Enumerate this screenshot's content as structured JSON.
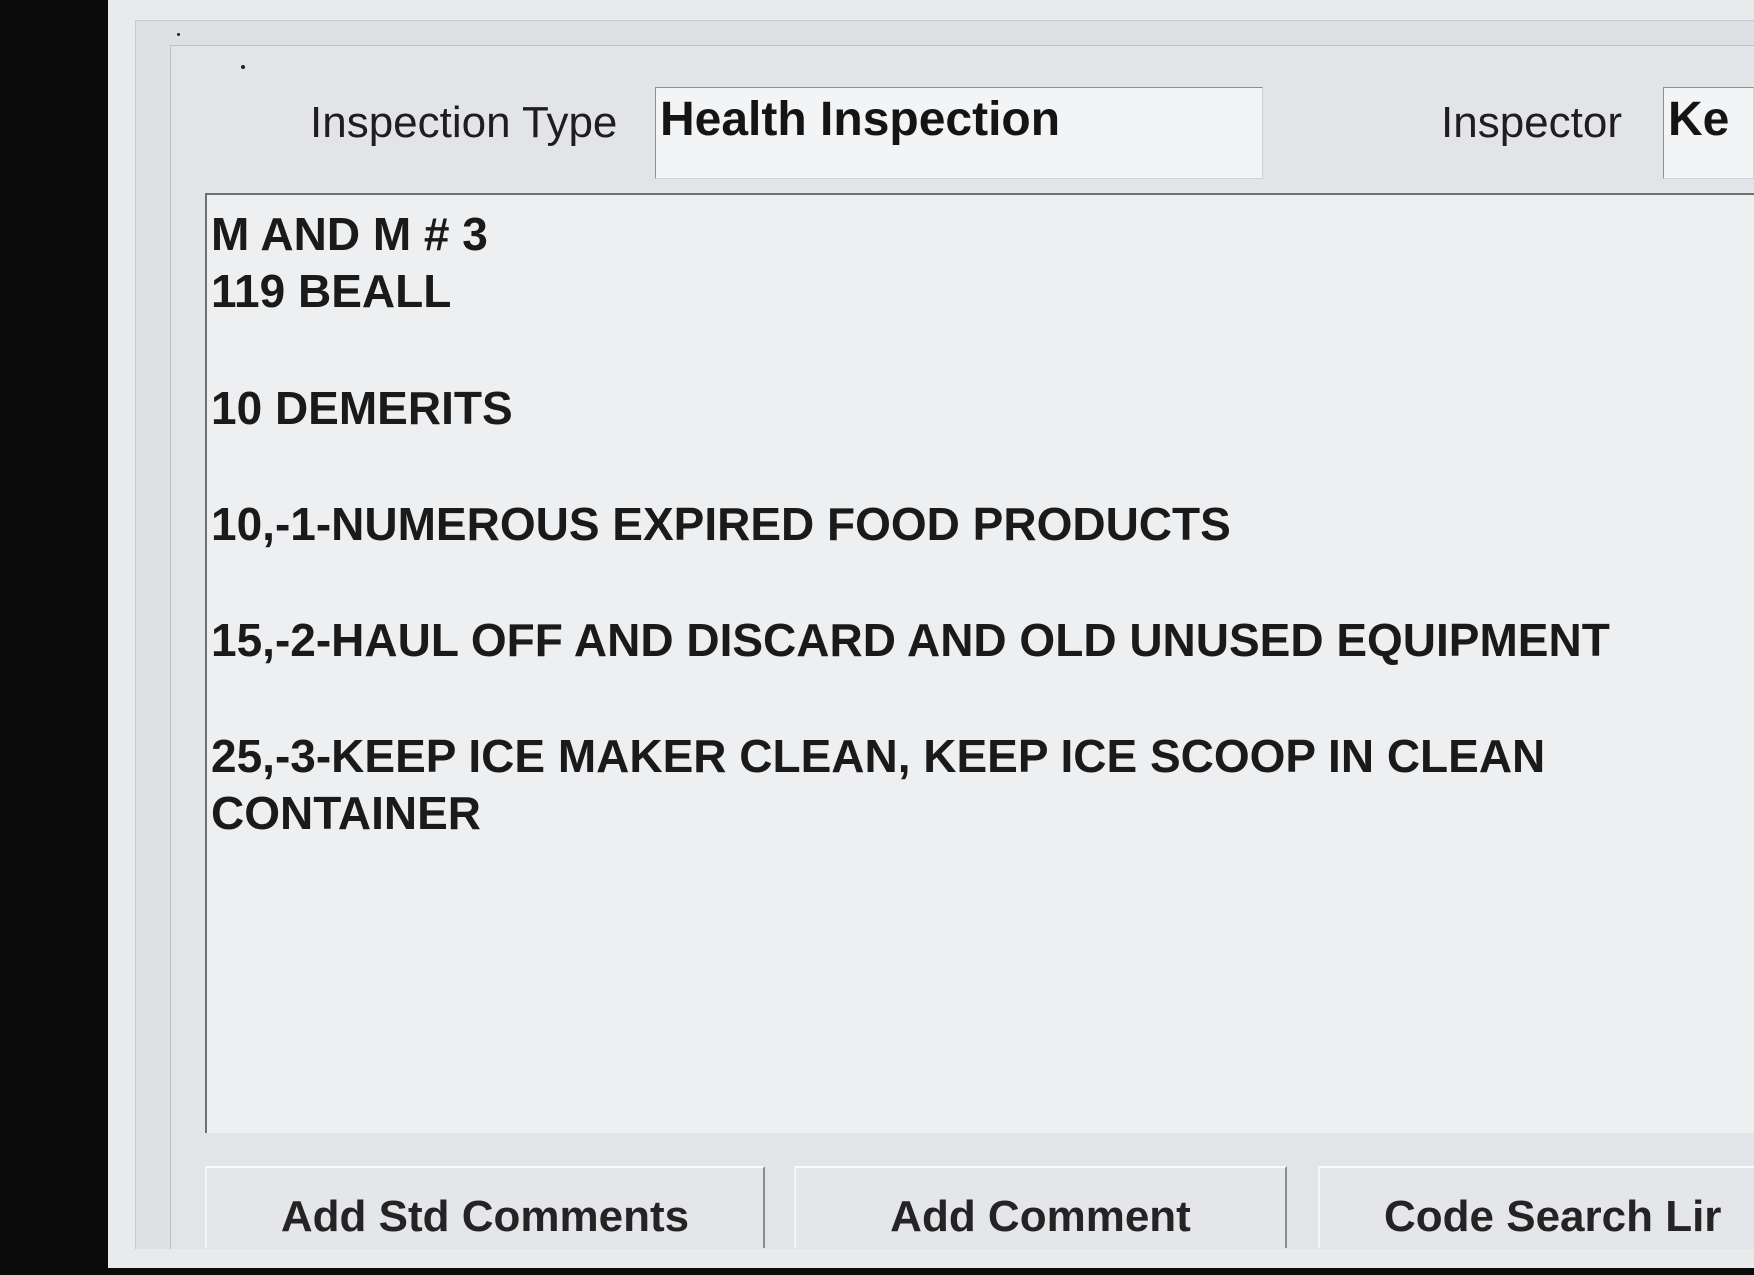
{
  "header": {
    "inspection_type_label": "Inspection Type",
    "inspection_type_value": "Health Inspection",
    "inspector_label": "Inspector",
    "inspector_value": "Ke"
  },
  "comments": {
    "lines": [
      "M AND M # 3",
      "119 BEALL",
      "",
      "10 DEMERITS",
      "",
      "10,-1-NUMEROUS EXPIRED FOOD PRODUCTS",
      "",
      "15,-2-HAUL OFF AND DISCARD AND OLD UNUSED EQUIPMENT",
      "",
      "25,-3-KEEP ICE MAKER CLEAN, KEEP ICE SCOOP IN CLEAN",
      "CONTAINER"
    ]
  },
  "buttons": {
    "add_std_comments": "Add Std Comments",
    "add_comment": "Add Comment",
    "code_search": "Code Search Lir"
  }
}
